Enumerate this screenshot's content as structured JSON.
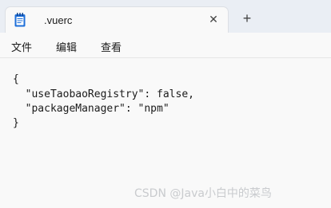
{
  "tab": {
    "title": ".vuerc",
    "close_glyph": "✕",
    "icon": "notepad-icon"
  },
  "new_tab_glyph": "+",
  "menu": {
    "items": [
      "文件",
      "编辑",
      "查看"
    ]
  },
  "editor": {
    "lines": [
      "{",
      "  \"useTaobaoRegistry\": false,",
      "  \"packageManager\": \"npm\"",
      "}"
    ]
  },
  "watermark": "CSDN @Java小白中的菜鸟",
  "colors": {
    "titlebar": "#eaeef4",
    "background": "#f9f9f9",
    "icon_blue": "#1e6fd9"
  }
}
